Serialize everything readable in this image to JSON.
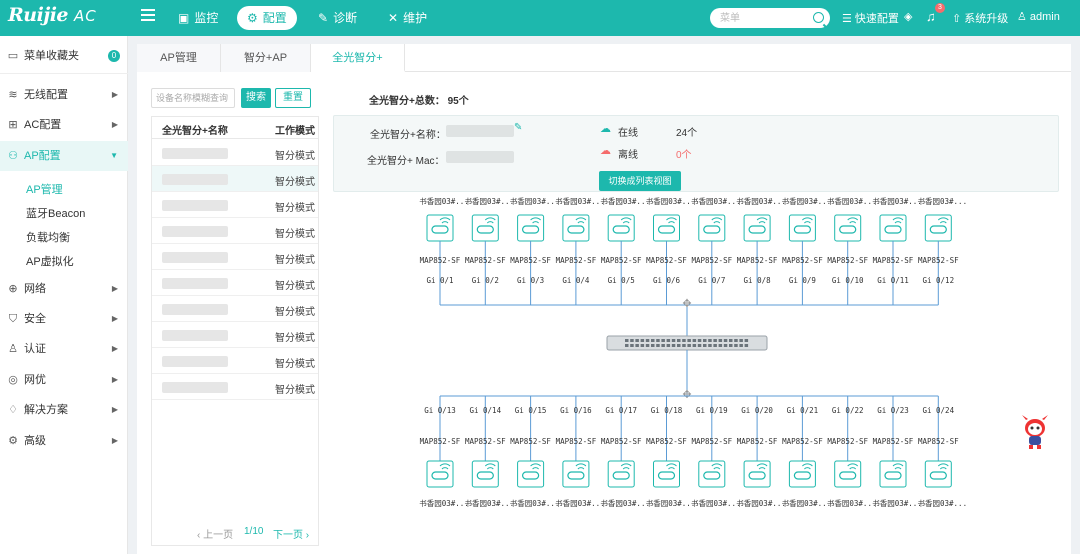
{
  "brand": {
    "logo": "Ruijie",
    "suffix": "AC"
  },
  "nav": [
    {
      "label": "监控",
      "icon": "monitor-icon"
    },
    {
      "label": "配置",
      "icon": "gear-icon",
      "active": true
    },
    {
      "label": "诊断",
      "icon": "diagnose-icon"
    },
    {
      "label": "维护",
      "icon": "maintain-icon"
    }
  ],
  "search": {
    "placeholder": "菜单"
  },
  "toolbar": {
    "quick_config": "快速配置",
    "notifications": 3,
    "upgrade": "系统升级",
    "user": "admin"
  },
  "sidebar": {
    "favorites": {
      "label": "菜单收藏夹",
      "count": "0"
    },
    "items": [
      {
        "label": "无线配置",
        "icon": "wifi-icon"
      },
      {
        "label": "AC配置",
        "icon": "ac-icon"
      },
      {
        "label": "AP配置",
        "icon": "ap-icon",
        "active": true
      },
      {
        "label": "网络",
        "icon": "network-icon"
      },
      {
        "label": "安全",
        "icon": "shield-icon"
      },
      {
        "label": "认证",
        "icon": "user-icon"
      },
      {
        "label": "网优",
        "icon": "optimize-icon"
      },
      {
        "label": "解决方案",
        "icon": "bulb-icon"
      },
      {
        "label": "高级",
        "icon": "advanced-icon"
      }
    ],
    "subitems": [
      {
        "label": "AP管理",
        "active": true
      },
      {
        "label": "蓝牙Beacon"
      },
      {
        "label": "负载均衡"
      },
      {
        "label": "AP虚拟化"
      }
    ]
  },
  "tabs": [
    {
      "label": "AP管理"
    },
    {
      "label": "智分+AP"
    },
    {
      "label": "全光智分+",
      "active": true
    }
  ],
  "filter": {
    "placeholder": "设备名称模糊查询",
    "search_label": "搜索",
    "reset_label": "重置"
  },
  "table": {
    "col_name": "全光智分+名称",
    "col_mode": "工作模式",
    "rows": [
      {
        "mode": "智分模式"
      },
      {
        "mode": "智分模式",
        "selected": true
      },
      {
        "mode": "智分模式"
      },
      {
        "mode": "智分模式"
      },
      {
        "mode": "智分模式"
      },
      {
        "mode": "智分模式"
      },
      {
        "mode": "智分模式"
      },
      {
        "mode": "智分模式"
      },
      {
        "mode": "智分模式"
      },
      {
        "mode": "智分模式"
      }
    ]
  },
  "pager": {
    "prev": "上一页",
    "current": "1/10",
    "next": "下一页"
  },
  "summary": {
    "total_label": "全光智分+总数：",
    "total": "95个"
  },
  "info": {
    "name_label": "全光智分+名称：",
    "mac_label": "全光智分+ Mac：",
    "online_label": "在线",
    "online_count": "24个",
    "offline_label": "离线",
    "offline_count": "0个",
    "switch_label": "切换成列表视图"
  },
  "colors": {
    "accent": "#1db8ad",
    "offline": "#f56c6c"
  },
  "topology": {
    "ap_top_label": "书香园03#...",
    "ap_model_label": "MAP852-SF",
    "ports_top": [
      "Gi 0/1",
      "Gi 0/2",
      "Gi 0/3",
      "Gi 0/4",
      "Gi 0/5",
      "Gi 0/6",
      "Gi 0/7",
      "Gi 0/8",
      "Gi 0/9",
      "Gi 0/10",
      "Gi 0/11",
      "Gi 0/12"
    ],
    "ports_bottom": [
      "Gi 0/13",
      "Gi 0/14",
      "Gi 0/15",
      "Gi 0/16",
      "Gi 0/17",
      "Gi 0/18",
      "Gi 0/19",
      "Gi 0/20",
      "Gi 0/21",
      "Gi 0/22",
      "Gi 0/23",
      "Gi 0/24"
    ]
  }
}
